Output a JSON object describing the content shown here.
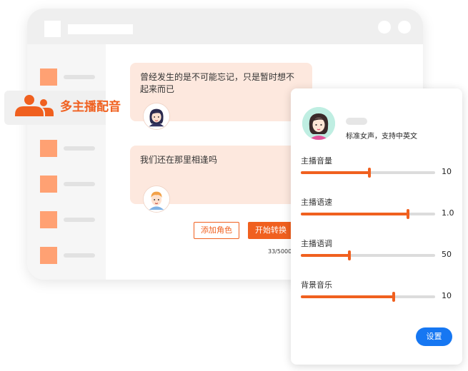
{
  "sidebar": {
    "active_label": "多主播配音",
    "active_icon": "people-icon"
  },
  "chat": {
    "messages": [
      {
        "text": "曾经发生的是不可能忘记，只是暂时想不起来而已",
        "avatar": "female-avatar-icon"
      },
      {
        "text": "我们还在那里相逢吗",
        "avatar": "male-avatar-icon"
      }
    ],
    "add_role_label": "添加角色",
    "start_convert_label": "开始转换",
    "char_count": "33/5000"
  },
  "panel": {
    "voice_description": "标准女声，支持中英文",
    "sliders": [
      {
        "label": "主播音量",
        "value": "10",
        "fraction": 0.51
      },
      {
        "label": "主播语速",
        "value": "1.0",
        "fraction": 0.8
      },
      {
        "label": "主播语调",
        "value": "50",
        "fraction": 0.36
      },
      {
        "label": "背景音乐",
        "value": "10",
        "fraction": 0.69
      }
    ],
    "settings_label": "设置"
  },
  "colors": {
    "accent": "#f0601f",
    "bubble": "#fde8de",
    "blue_button": "#1677f2"
  }
}
